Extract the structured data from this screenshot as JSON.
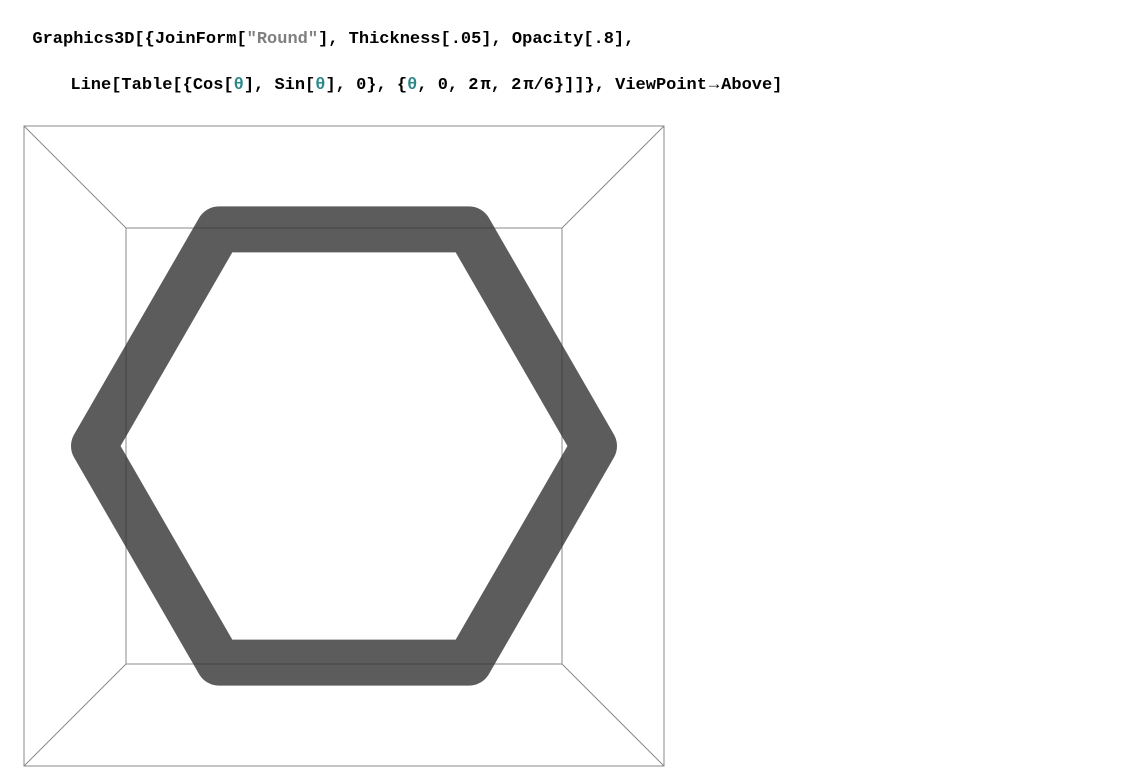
{
  "code": {
    "line1": {
      "s1": "Graphics3D[{JoinForm[",
      "q1": "\"",
      "s2": "Round",
      "q2": "\"",
      "s3": "], Thickness[.05], Opacity[.8],"
    },
    "line2": {
      "s1": "Line[Table[{Cos[",
      "v1": "θ",
      "s2": "], Sin[",
      "v2": "θ",
      "s3": "], 0}, {",
      "v3": "θ",
      "s4": ", 0, 2",
      "pi1": "π",
      "s5": ", 2",
      "pi2": "π",
      "s6": "/6}]]}, ViewPoint",
      "arrow": "→",
      "s7": "Above]"
    }
  },
  "graphic": {
    "hexagon": {
      "thickness_value": 0.05,
      "opacity_value": 0.8,
      "join_form": "Round",
      "vertices_deg": [
        0,
        60,
        120,
        180,
        240,
        300,
        360
      ],
      "stroke_color": "#333333"
    },
    "box_line_color": "#8a8a8a"
  }
}
